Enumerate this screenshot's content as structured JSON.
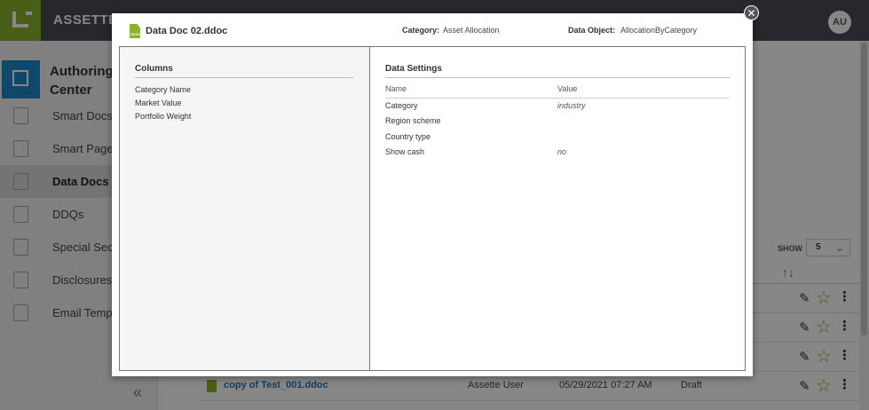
{
  "app": {
    "brand": "ASSETTE",
    "user_initials": "AU",
    "authoring_title": "Authoring Center",
    "sidebar_items": [
      {
        "label": "Smart Docs",
        "icon": "grid-icon"
      },
      {
        "label": "Smart Pages",
        "icon": "page-icon"
      },
      {
        "label": "Data Docs",
        "icon": "database-icon"
      },
      {
        "label": "DDQs",
        "icon": "sheet-icon"
      },
      {
        "label": "Special Secti",
        "icon": "chart-page-icon"
      },
      {
        "label": "Disclosures",
        "icon": "disclosure-icon"
      },
      {
        "label": "Email Templa",
        "icon": "email-template-icon"
      }
    ],
    "active_item": "Data Docs",
    "collapse_glyph": "«",
    "show_label": "SHOW",
    "show_value": "5",
    "last_row": {
      "name": "copy of Test_001.ddoc",
      "author": "Assette User",
      "modified": "05/29/2021 07:27 AM",
      "status": "Draft"
    }
  },
  "modal": {
    "title": "Data Doc 02.ddoc",
    "category_label": "Category:",
    "category_value": "Asset Allocation",
    "data_object_label": "Data Object:",
    "data_object_value": "AllocationByCategory",
    "file_badge": "DDOC",
    "columns_title": "Columns",
    "columns": [
      "Category Name",
      "Market Value",
      "Portfolio Weight"
    ],
    "settings_title": "Data Settings",
    "settings_header_name": "Name",
    "settings_header_value": "Value",
    "settings": [
      {
        "name": "Category",
        "value": "industry"
      },
      {
        "name": "Region scheme",
        "value": ""
      },
      {
        "name": "Country type",
        "value": ""
      },
      {
        "name": "Show cash",
        "value": "no"
      }
    ]
  },
  "colors": {
    "accent_green": "#8cb32b",
    "topbar": "#4a4d52",
    "authoring_blue": "#1e88c8"
  }
}
